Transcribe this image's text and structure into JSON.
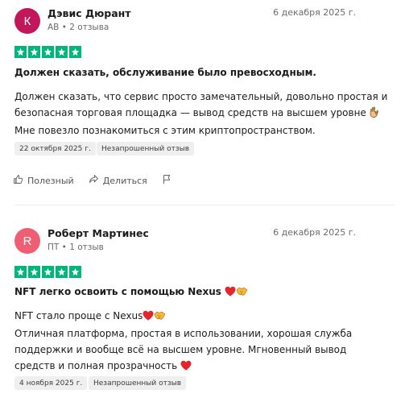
{
  "reviews": [
    {
      "initial": "К",
      "avatar_color": "#c2185b",
      "name": "Дэвис Дюрант",
      "country": "AB",
      "reviews_count": "2 отзыва",
      "date": "6 декабря 2025 г.",
      "rating": 5,
      "title": "Должен сказать, обслуживание было превосходным.",
      "body_lines": [
        "Должен сказать, что сервис просто замечательный, довольно простая и",
        "безопасная торговая площадка — вывод средств на высшем уровне",
        "Мне повезло познакомиться с этим криптопространством."
      ],
      "experience_date": "22 октября 2025 г.",
      "badge": "Незапрошенный отзыв",
      "actions": {
        "useful": "Полезный",
        "share": "Делиться"
      }
    },
    {
      "initial": "R",
      "avatar_color": "#ef5f73",
      "name": "Роберт Мартинес",
      "country": "ПТ",
      "reviews_count": "1 отзыв",
      "date": "6 декабря 2025 г.",
      "rating": 5,
      "title": "NFT легко освоить с помощью Nexus",
      "body_lines": [
        "NFT стало проще с Nexus",
        "Отличная платформа, простая в использовании, хорошая служба",
        "поддержки и вообще всё на высшем уровне. Мгновенный вывод",
        "средств и полная прозрачность"
      ],
      "experience_date": "4 ноября 2025 г.",
      "badge": "Незапрошенный отзыв"
    }
  ],
  "meta_separator": "•",
  "colors": {
    "star_green": "#00b67a"
  },
  "icons": [
    "thumb-up-icon",
    "share-icon",
    "flag-icon",
    "heart-emoji",
    "handshake-emoji",
    "ok-hand-emoji"
  ]
}
